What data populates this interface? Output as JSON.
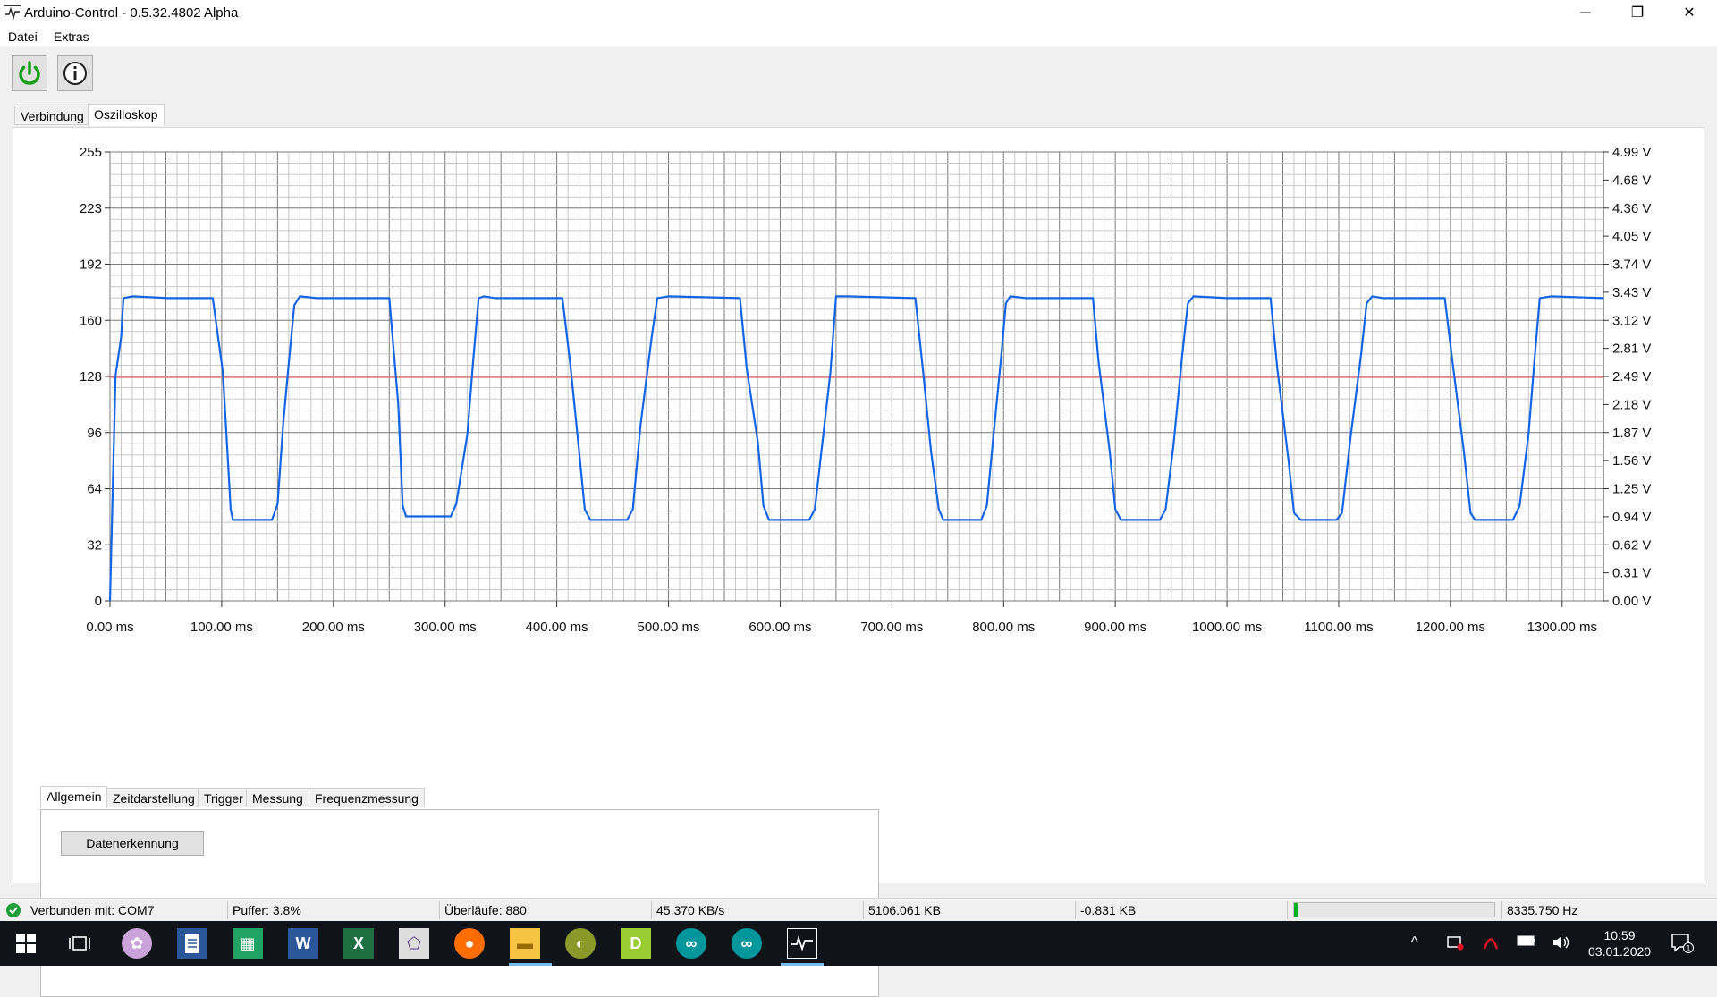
{
  "window": {
    "title": "Arduino-Control - 0.5.32.4802  Alpha",
    "minimize": "─",
    "maximize": "❐",
    "close": "✕"
  },
  "menu": [
    "Datei",
    "Extras"
  ],
  "tabs": [
    "Verbindung",
    "Oszilloskop"
  ],
  "subtabs": [
    "Allgemein",
    "Zeitdarstellung",
    "Trigger",
    "Messung",
    "Frequenzmessung"
  ],
  "buttons": {
    "datenerkennung": "Datenerkennung"
  },
  "chart_data": {
    "type": "line",
    "xlabels": [
      "0.00 ms",
      "100.00 ms",
      "200.00 ms",
      "300.00 ms",
      "400.00 ms",
      "500.00 ms",
      "600.00 ms",
      "700.00 ms",
      "800.00 ms",
      "900.00 ms",
      "1000.00 ms",
      "1100.00 ms",
      "1200.00 ms",
      "1300.00 ms"
    ],
    "ylabels_left": [
      "255",
      "223",
      "192",
      "160",
      "128",
      "96",
      "64",
      "32",
      "0"
    ],
    "ylabels_right": [
      "4.99 V",
      "4.68 V",
      "4.36 V",
      "4.05 V",
      "3.74 V",
      "3.43 V",
      "3.12 V",
      "2.81 V",
      "2.49 V",
      "2.18 V",
      "1.87 V",
      "1.56 V",
      "1.25 V",
      "0.94 V",
      "0.62 V",
      "0.31 V",
      "0.00 V"
    ],
    "xlim": [
      0,
      1337
    ],
    "ylim": [
      0,
      255
    ],
    "trigger_level": 127,
    "colors": {
      "signal": "#1464e6",
      "trigger": "#ea8a7a",
      "grid_minor": "#c8c8c8",
      "grid_major": "#7a7a7a"
    },
    "series": [
      {
        "points": [
          [
            0,
            0
          ],
          [
            5,
            128
          ],
          [
            10,
            150
          ],
          [
            12,
            172
          ],
          [
            20,
            173
          ],
          [
            52,
            172
          ],
          [
            92,
            172
          ],
          [
            101,
            130
          ],
          [
            106,
            75
          ],
          [
            108,
            52
          ],
          [
            110,
            46
          ],
          [
            145,
            46
          ],
          [
            150,
            55
          ],
          [
            155,
            100
          ],
          [
            160,
            135
          ],
          [
            165,
            168
          ],
          [
            170,
            173
          ],
          [
            185,
            172
          ],
          [
            250,
            172
          ],
          [
            258,
            112
          ],
          [
            262,
            54
          ],
          [
            265,
            48
          ],
          [
            305,
            48
          ],
          [
            310,
            55
          ],
          [
            320,
            95
          ],
          [
            325,
            135
          ],
          [
            330,
            172
          ],
          [
            335,
            173
          ],
          [
            345,
            172
          ],
          [
            405,
            172
          ],
          [
            412,
            135
          ],
          [
            420,
            85
          ],
          [
            425,
            52
          ],
          [
            430,
            46
          ],
          [
            463,
            46
          ],
          [
            468,
            52
          ],
          [
            475,
            100
          ],
          [
            485,
            150
          ],
          [
            490,
            172
          ],
          [
            500,
            173
          ],
          [
            564,
            172
          ],
          [
            570,
            132
          ],
          [
            580,
            90
          ],
          [
            585,
            54
          ],
          [
            590,
            46
          ],
          [
            626,
            46
          ],
          [
            631,
            52
          ],
          [
            636,
            80
          ],
          [
            645,
            130
          ],
          [
            650,
            173
          ],
          [
            660,
            173
          ],
          [
            721,
            172
          ],
          [
            728,
            130
          ],
          [
            735,
            85
          ],
          [
            742,
            52
          ],
          [
            746,
            46
          ],
          [
            780,
            46
          ],
          [
            785,
            54
          ],
          [
            790,
            88
          ],
          [
            798,
            140
          ],
          [
            802,
            169
          ],
          [
            806,
            173
          ],
          [
            820,
            172
          ],
          [
            880,
            172
          ],
          [
            885,
            136
          ],
          [
            895,
            85
          ],
          [
            900,
            52
          ],
          [
            905,
            46
          ],
          [
            940,
            46
          ],
          [
            945,
            52
          ],
          [
            952,
            88
          ],
          [
            960,
            140
          ],
          [
            965,
            169
          ],
          [
            970,
            173
          ],
          [
            1000,
            172
          ],
          [
            1039,
            172
          ],
          [
            1045,
            132
          ],
          [
            1055,
            80
          ],
          [
            1060,
            50
          ],
          [
            1066,
            46
          ],
          [
            1098,
            46
          ],
          [
            1103,
            50
          ],
          [
            1110,
            90
          ],
          [
            1120,
            140
          ],
          [
            1125,
            169
          ],
          [
            1130,
            173
          ],
          [
            1140,
            172
          ],
          [
            1195,
            172
          ],
          [
            1202,
            135
          ],
          [
            1212,
            85
          ],
          [
            1218,
            50
          ],
          [
            1222,
            46
          ],
          [
            1256,
            46
          ],
          [
            1262,
            54
          ],
          [
            1270,
            95
          ],
          [
            1275,
            135
          ],
          [
            1280,
            172
          ],
          [
            1290,
            173
          ],
          [
            1337,
            172
          ]
        ]
      }
    ]
  },
  "status": {
    "connected": "Verbunden mit: COM7",
    "puffer": "Puffer: 3.8%",
    "ueberlaeufe": "Überläufe: 880",
    "rate": "45.370 KB/s",
    "total": "5106.061 KB",
    "diff": "-0.831 KB",
    "progress": 0.02,
    "frequency": "8335.750 Hz"
  },
  "taskbar": {
    "time": "10:59",
    "date": "03.01.2020",
    "notifications": "1"
  }
}
